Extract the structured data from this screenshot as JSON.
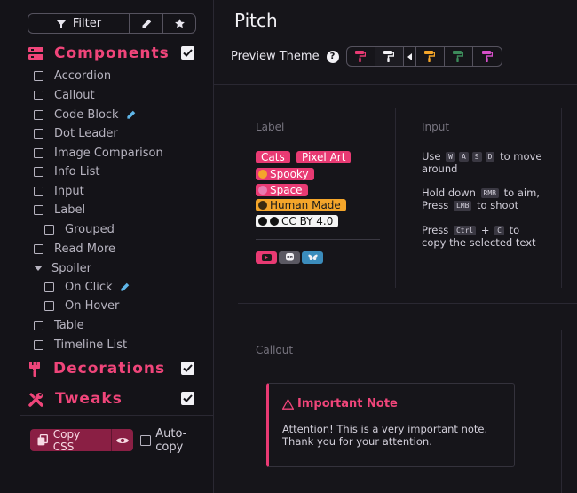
{
  "sidebar": {
    "filter_label": "Filter",
    "sections": [
      {
        "label": "Components",
        "checked": true
      },
      {
        "label": "Decorations",
        "checked": true
      },
      {
        "label": "Tweaks",
        "checked": true
      }
    ],
    "items": [
      "Accordion",
      "Callout",
      "Code Block",
      "Dot Leader",
      "Image Comparison",
      "Info List",
      "Input",
      "Label",
      "Grouped",
      "Read More",
      "Spoiler",
      "On Click",
      "On Hover",
      "Table",
      "Timeline List"
    ],
    "copy_label": "Copy CSS",
    "autocopy_label": "Auto-copy"
  },
  "main": {
    "title": "Pitch",
    "preview_theme_label": "Preview Theme",
    "help_glyph": "?",
    "themes": [
      "#e83a73",
      "#f2f1f5",
      "#f4a52a",
      "#3c8a5a",
      "#d64fc9"
    ],
    "label_col": {
      "heading": "Label",
      "tags": [
        "Cats",
        "Pixel Art",
        "Spooky",
        "Space",
        "Human Made",
        "CC BY 4.0"
      ]
    },
    "input_col": {
      "heading": "Input",
      "line1_pre": "Use",
      "line1_keys": [
        "W",
        "A",
        "S",
        "D"
      ],
      "line1_post": "to move around",
      "line2_pre": "Hold down",
      "line2_key1": "RMB",
      "line2_mid": "to aim, Press",
      "line2_key2": "LMB",
      "line2_post": "to shoot",
      "line3_pre": "Press",
      "line3_key1": "Ctrl",
      "line3_plus": "+",
      "line3_key2": "C",
      "line3_post": "to copy the selected text"
    },
    "callout": {
      "heading": "Callout",
      "note_title": "Important Note",
      "note_text": "Attention! This is a very important note. Thank you for your attention."
    }
  },
  "colors": {
    "accent": "#f0457a",
    "accent_dark": "#8a1f44",
    "bg": "#16151a"
  }
}
